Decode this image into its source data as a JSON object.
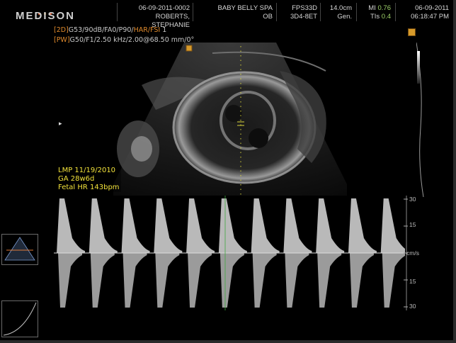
{
  "header": {
    "logo": "MEDISON",
    "patient_id": "06-09-2011-0002",
    "patient_name": "ROBERTS, STEPHANIE",
    "facility": "BABY BELLY SPA",
    "exam": "OB",
    "fps": "FPS33D",
    "probe": "3D4-8ET",
    "depth": "14.0cm",
    "preset": "Gen.",
    "mi_label": "MI",
    "mi_value": "0.76",
    "tis_label": "TIs",
    "tis_value": "0.4",
    "date": "06-09-2011",
    "time": "06:18:47 PM"
  },
  "params": {
    "line1_tag": "[2D]",
    "line1_a": "G53/90dB/FA0/P90/",
    "line1_b": "HAR/FSI",
    "line1_c": " 1",
    "line2_tag": "[PW]",
    "line2_text": "G50/F1/2.50 kHz/2.00@68.50 mm/0°"
  },
  "measurements": {
    "lmp": "LMP 11/19/2010",
    "ga": "GA   28w6d",
    "hr": "Fetal HR 143bpm"
  },
  "doppler_scale": {
    "top": "30",
    "upper_mid": "15",
    "unit": "cm/s",
    "lower_mid": "15",
    "bottom": "30"
  },
  "colors": {
    "accent_orange": "#e08a2c",
    "meas_yellow": "#f2e23a",
    "mi_green": "#9fd36a",
    "sample_gate": "#d7d23a"
  }
}
